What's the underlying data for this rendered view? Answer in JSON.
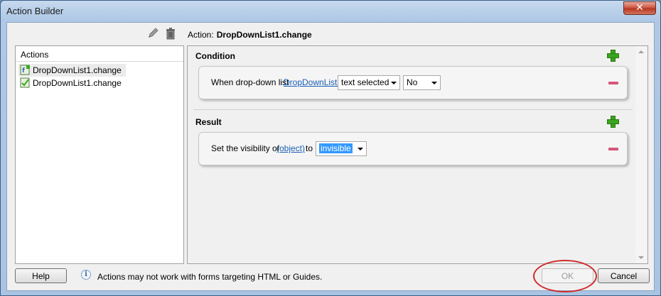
{
  "window": {
    "title": "Action Builder",
    "close_glyph": "✕"
  },
  "toolbar": {
    "icons": [
      "edit-icon",
      "trash-icon"
    ]
  },
  "action_heading": {
    "label": "Action:",
    "value": "DropDownList1.change"
  },
  "actions_panel": {
    "header": "Actions",
    "items": [
      {
        "label": "DropDownList1.change",
        "selected": true,
        "icon": "action-script-icon"
      },
      {
        "label": "DropDownList1.change",
        "selected": false,
        "icon": "action-script-check-icon"
      }
    ]
  },
  "condition": {
    "title": "Condition",
    "prefix": "When drop-down list",
    "object_link": "DropDownList1",
    "event_select": "text selected",
    "value_select": "No"
  },
  "result": {
    "title": "Result",
    "prefix": "Set the visibility of",
    "object_link": "(object)",
    "connector": "to",
    "visibility_select": "invisible"
  },
  "footer": {
    "help_label": "Help",
    "info_text": "Actions may not work with forms targeting HTML or Guides.",
    "ok_label": "OK",
    "cancel_label": "Cancel"
  },
  "colors": {
    "add_green": "#3aa51e",
    "remove_pink": "#d7567a",
    "link_blue": "#1a5fb4",
    "highlight_red": "#d12c2c"
  }
}
